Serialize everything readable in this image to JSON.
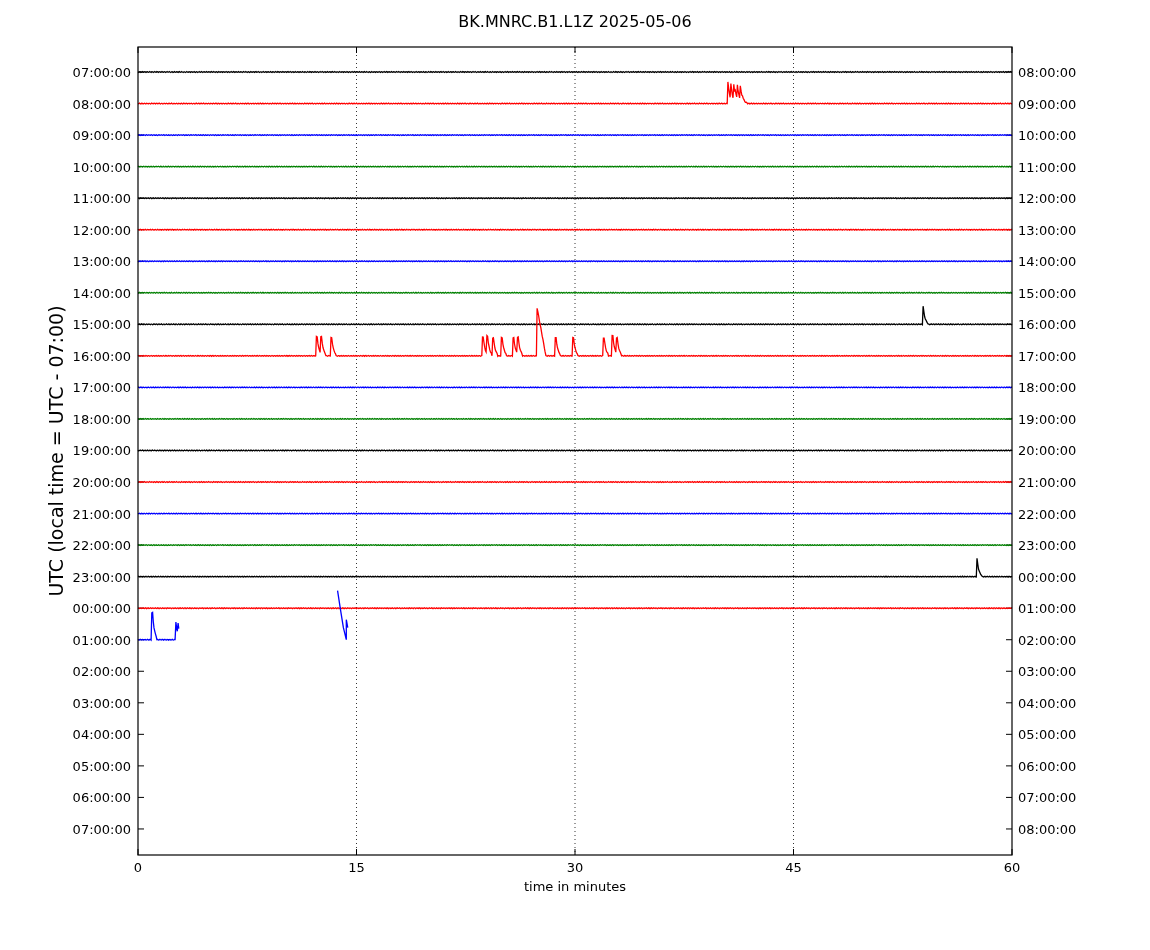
{
  "title": "BK.MNRC.B1.L1Z 2025-05-06",
  "ylabel": "UTC (local time = UTC - 07:00)",
  "xlabel": "time in minutes",
  "xticks": [
    "0",
    "15",
    "30",
    "45",
    "60"
  ],
  "left_ticks": [
    "07:00:00",
    "08:00:00",
    "09:00:00",
    "10:00:00",
    "11:00:00",
    "12:00:00",
    "13:00:00",
    "14:00:00",
    "15:00:00",
    "16:00:00",
    "17:00:00",
    "18:00:00",
    "19:00:00",
    "20:00:00",
    "21:00:00",
    "22:00:00",
    "23:00:00",
    "00:00:00",
    "01:00:00",
    "02:00:00",
    "03:00:00",
    "04:00:00",
    "05:00:00",
    "06:00:00",
    "07:00:00"
  ],
  "right_ticks": [
    "08:00:00",
    "09:00:00",
    "10:00:00",
    "11:00:00",
    "12:00:00",
    "13:00:00",
    "14:00:00",
    "15:00:00",
    "16:00:00",
    "17:00:00",
    "18:00:00",
    "19:00:00",
    "20:00:00",
    "21:00:00",
    "22:00:00",
    "23:00:00",
    "00:00:00",
    "01:00:00",
    "02:00:00",
    "03:00:00",
    "04:00:00",
    "05:00:00",
    "06:00:00",
    "07:00:00",
    "08:00:00"
  ],
  "traces": [
    {
      "color": "#000000"
    },
    {
      "color": "#ff0000"
    },
    {
      "color": "#0000ff"
    },
    {
      "color": "#008000"
    },
    {
      "color": "#000000"
    },
    {
      "color": "#ff0000"
    },
    {
      "color": "#0000ff"
    },
    {
      "color": "#008000"
    },
    {
      "color": "#000000"
    },
    {
      "color": "#ff0000"
    },
    {
      "color": "#0000ff"
    },
    {
      "color": "#008000"
    },
    {
      "color": "#000000"
    },
    {
      "color": "#ff0000"
    },
    {
      "color": "#0000ff"
    },
    {
      "color": "#008000"
    },
    {
      "color": "#000000"
    },
    {
      "color": "#ff0000"
    },
    {
      "color": "#0000ff"
    }
  ]
}
